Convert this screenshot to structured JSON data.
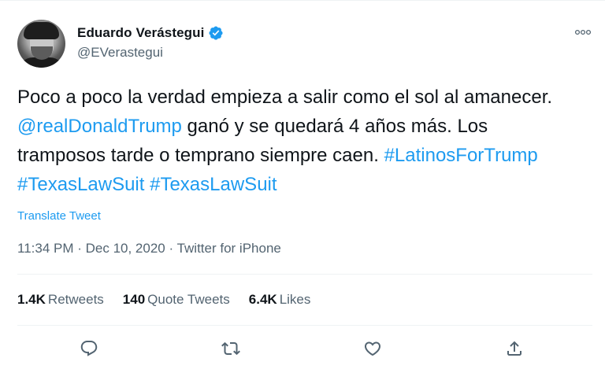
{
  "tweet": {
    "author": {
      "display_name": "Eduardo Verástegui",
      "handle": "@EVerastegui",
      "verified": true
    },
    "text": [
      {
        "t": "Poco a poco la verdad empieza a salir como el sol al amanecer. ",
        "link": false
      },
      {
        "t": "@realDonaldTrump",
        "link": true
      },
      {
        "t": " ganó y se quedará 4 años más. Los tramposos tarde o temprano siempre caen. ",
        "link": false
      },
      {
        "t": "#LatinosForTrump",
        "link": true
      },
      {
        "t": " ",
        "link": false
      },
      {
        "t": "#TexasLawSuit",
        "link": true
      },
      {
        "t": " ",
        "link": false
      },
      {
        "t": "#TexasLawSuit",
        "link": true
      }
    ],
    "translate_label": "Translate Tweet",
    "meta": {
      "time": "11:34 PM",
      "separator": " · ",
      "date": "Dec 10, 2020",
      "source": "Twitter for iPhone"
    },
    "stats": {
      "retweets_count": "1.4K",
      "retweets_label": "Retweets",
      "quotes_count": "140",
      "quotes_label": "Quote Tweets",
      "likes_count": "6.4K",
      "likes_label": "Likes"
    },
    "actions": [
      "reply-icon",
      "retweet-icon",
      "like-icon",
      "share-icon"
    ]
  },
  "colors": {
    "link": "#1d9bf0",
    "secondary_text": "#536471",
    "primary_text": "#0f1419",
    "divider": "#eff3f4"
  }
}
